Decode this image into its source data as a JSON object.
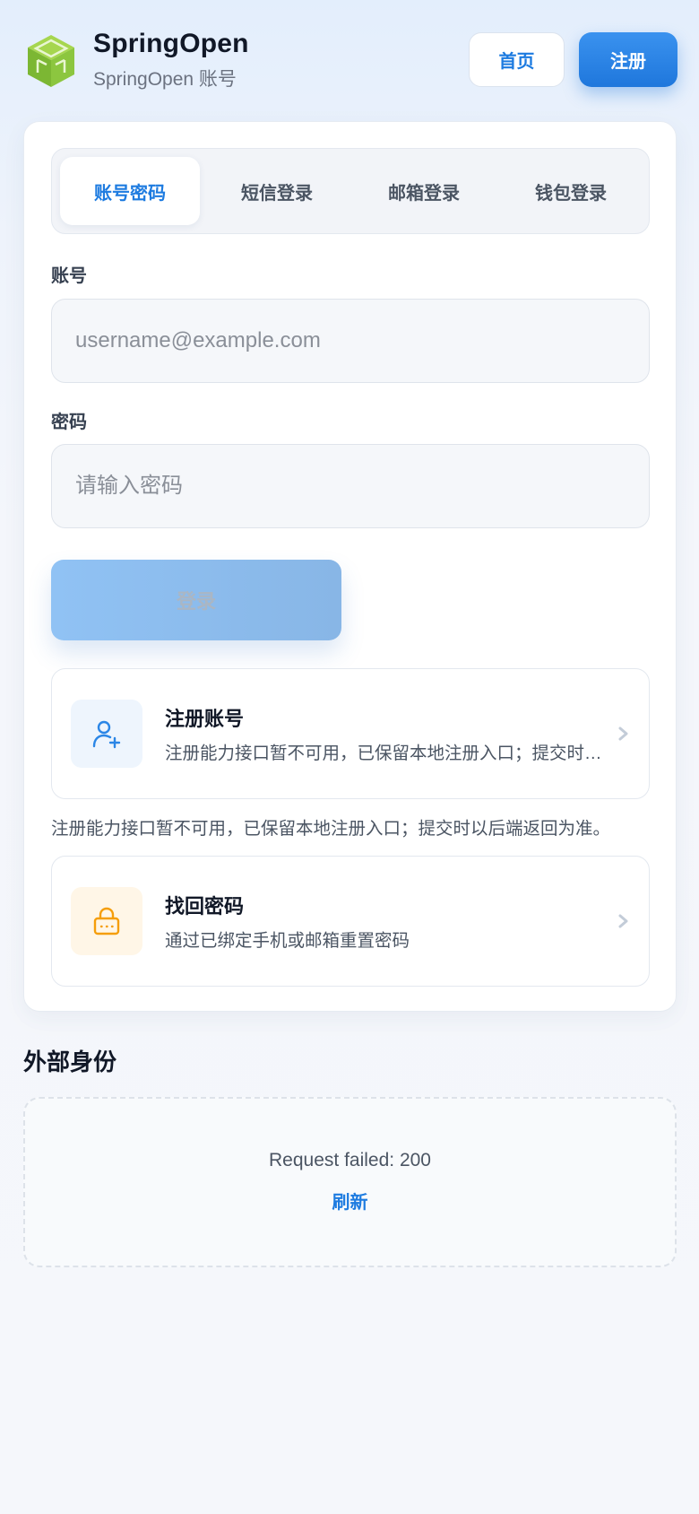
{
  "header": {
    "brand_name": "SpringOpen",
    "brand_sub": "SpringOpen 账号",
    "home_label": "首页",
    "register_label": "注册"
  },
  "tabs": [
    {
      "label": "账号密码",
      "active": true
    },
    {
      "label": "短信登录",
      "active": false
    },
    {
      "label": "邮箱登录",
      "active": false
    },
    {
      "label": "钱包登录",
      "active": false
    }
  ],
  "form": {
    "account_label": "账号",
    "account_placeholder": "username@example.com",
    "account_value": "",
    "password_label": "密码",
    "password_placeholder": "请输入密码",
    "password_value": "",
    "login_label": "登录"
  },
  "register_card": {
    "icon": "user-plus-icon",
    "title": "注册账号",
    "desc": "注册能力接口暂不可用，已保留本地注册入口；提交时以后端返回为准。"
  },
  "register_note": "注册能力接口暂不可用，已保留本地注册入口；提交时以后端返回为准。",
  "reset_card": {
    "icon": "lock-icon",
    "title": "找回密码",
    "desc": "通过已绑定手机或邮箱重置密码"
  },
  "external": {
    "title": "外部身份",
    "error": "Request failed: 200",
    "refresh_label": "刷新"
  },
  "colors": {
    "accent": "#1d7be0",
    "logo_green": "#8cc63f",
    "warning_orange": "#f59e0b"
  }
}
